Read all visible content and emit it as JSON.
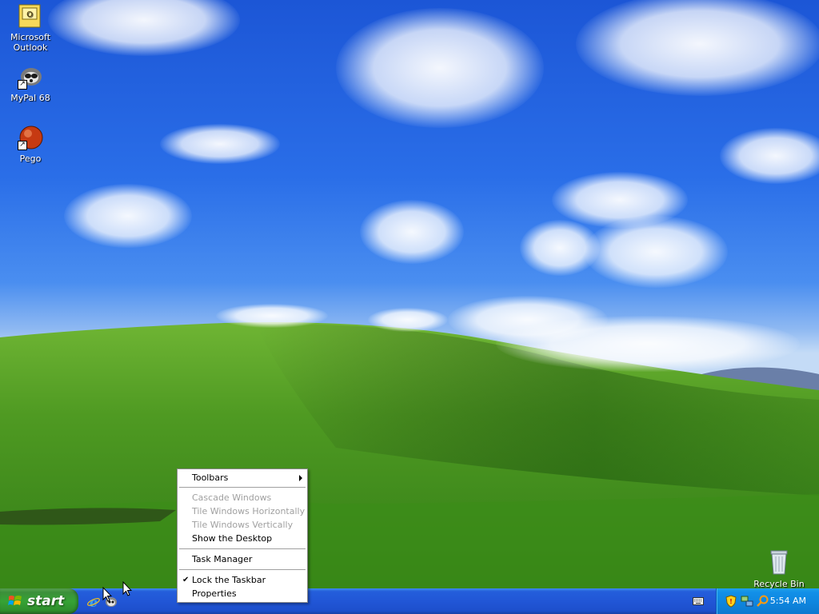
{
  "desktop": {
    "icons": [
      {
        "label_line1": "Microsoft",
        "label_line2": "Outlook",
        "icon": "outlook-icon"
      },
      {
        "label": "MyPal 68",
        "icon": "mypal-icon"
      },
      {
        "label": "Pego",
        "icon": "pego-icon"
      }
    ],
    "recycle_bin": {
      "label": "Recycle Bin",
      "icon": "recycle-bin-icon"
    }
  },
  "context_menu": {
    "items": [
      {
        "label": "Toolbars",
        "enabled": true,
        "submenu": true
      },
      {
        "label": "Cascade Windows",
        "enabled": false
      },
      {
        "label": "Tile Windows Horizontally",
        "enabled": false
      },
      {
        "label": "Tile Windows Vertically",
        "enabled": false
      },
      {
        "label": "Show the Desktop",
        "enabled": true
      },
      {
        "label": "Task Manager",
        "enabled": true
      },
      {
        "label": "Lock the Taskbar",
        "enabled": true,
        "checked": true
      },
      {
        "label": "Properties",
        "enabled": true
      }
    ]
  },
  "taskbar": {
    "start_label": "start",
    "quick_launch": [
      "internet-explorer-icon",
      "mypal-icon"
    ],
    "tray": {
      "icons": [
        "keyboard-icon",
        "security-shield-icon",
        "network-icon",
        "search-icon"
      ],
      "clock": "5:54 AM"
    }
  },
  "colors": {
    "taskbar_blue": "#245edb",
    "start_green": "#36a335",
    "tray_blue": "#0f87e0",
    "disabled_text": "#a0a0a0"
  }
}
